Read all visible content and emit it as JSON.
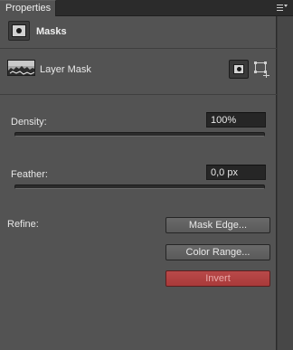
{
  "tab": {
    "title": "Properties"
  },
  "header": {
    "title": "Masks"
  },
  "layer": {
    "label": "Layer Mask"
  },
  "density": {
    "label": "Density:",
    "value": "100%",
    "level": 1.0
  },
  "feather": {
    "label": "Feather:",
    "value": "0,0 px",
    "level": 0.0
  },
  "refine": {
    "label": "Refine:"
  },
  "buttons": {
    "mask_edge": "Mask Edge...",
    "color_range": "Color Range...",
    "invert": "Invert"
  },
  "colors": {
    "panel": "#535353",
    "accent_invert": "#b84a4a"
  },
  "icons": [
    "panel-menu-icon",
    "mask-icon",
    "pixel-mask-icon",
    "vector-mask-icon"
  ]
}
